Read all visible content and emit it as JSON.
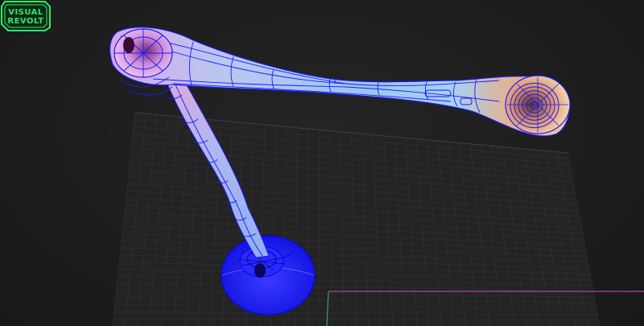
{
  "viewport": {
    "background_color": "#1d1d1d",
    "grid_color": "#3a3a3a",
    "wire_color": "#1a1aff",
    "axis_x_color": "#b040b0",
    "axis_y_color": "#30a070",
    "model": "tube-object"
  },
  "logo": {
    "line1": "VISUAL",
    "line2": "REVOLT",
    "color": "#2ee86a",
    "icon": "visual-revolt-logo-icon"
  }
}
